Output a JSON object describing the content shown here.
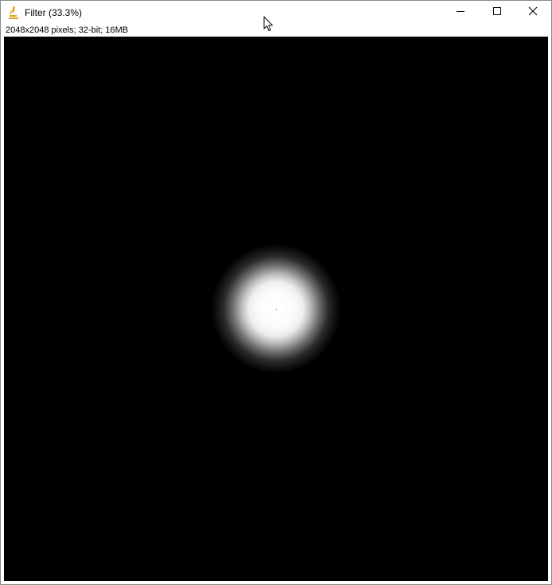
{
  "window": {
    "title": "Filter (33.3%)",
    "status": "2048x2048 pixels; 32-bit; 16MB"
  },
  "titlebar": {
    "app_icon": "microscope-icon",
    "buttons": {
      "minimize_icon": "minimize-icon",
      "maximize_icon": "maximize-icon",
      "close_icon": "close-icon"
    }
  },
  "image": {
    "description_icon": "radial-gaussian-spot"
  },
  "colors": {
    "canvas_background": "#000000",
    "spot": "#ffffff",
    "icon_accent": "#e0a020"
  }
}
